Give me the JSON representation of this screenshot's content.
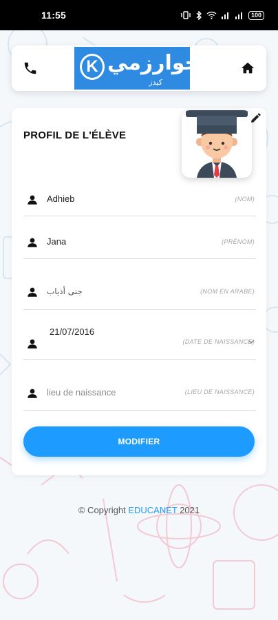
{
  "status_bar": {
    "time": "11:55",
    "battery": "100"
  },
  "header": {
    "logo_arabic": "الخوارزمي",
    "logo_subtitle": "كيدز",
    "phone_icon": "phone-icon",
    "home_icon": "home-icon"
  },
  "profile": {
    "title": "PROFIL DE L'ÉLÈVE",
    "edit_icon": "edit-icon"
  },
  "fields": [
    {
      "value": "Adhieb",
      "label": "(NOM)",
      "is_placeholder": false
    },
    {
      "value": "Jana",
      "label": "(PRÉNOM)",
      "is_placeholder": false
    },
    {
      "value": "جنى أذياب",
      "label": "(NOM EN ARABE)",
      "is_placeholder": false
    },
    {
      "value": "21/07/2016",
      "label": "(DATE DE NAISSANCE)",
      "is_placeholder": false
    },
    {
      "value": "lieu de naissance",
      "label": "(LIEU DE NAISSANCE)",
      "is_placeholder": true
    }
  ],
  "actions": {
    "modify_label": "MODIFIER"
  },
  "footer": {
    "prefix": "© Copyright ",
    "brand": "EDUCANET",
    "year": " 2021"
  },
  "colors": {
    "accent": "#1e9bff",
    "logo_bg": "#2f8be2"
  }
}
